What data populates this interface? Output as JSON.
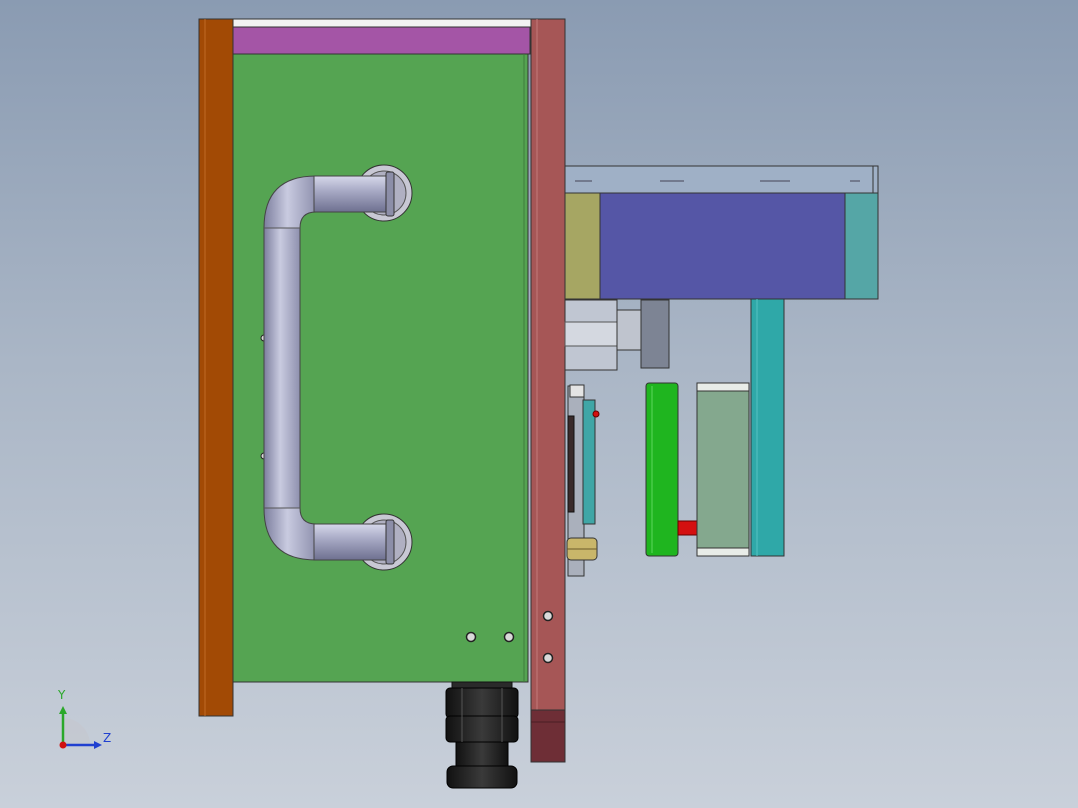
{
  "viewport": {
    "background_top": "#8a9bb2",
    "background_bottom": "#c9d0da"
  },
  "colors": {
    "left_plate": "#a24a05",
    "top_bar": "#a455a6",
    "green_plate": "#55a452",
    "right_plate": "#a65656",
    "handle": "#a9abc6",
    "olive_block": "#a6a663",
    "blue_block": "#5556a6",
    "teal": "#2fa8a8",
    "green_block": "#1fb51f",
    "sage_block": "#84a88e",
    "red_pin": "#d41010",
    "dark_knob": "#1e1e1e"
  },
  "triad": {
    "y_label": "Y",
    "z_label": "Z",
    "y_color": "#2aa82a",
    "z_color": "#2040d0",
    "x_color": "#d01010"
  }
}
